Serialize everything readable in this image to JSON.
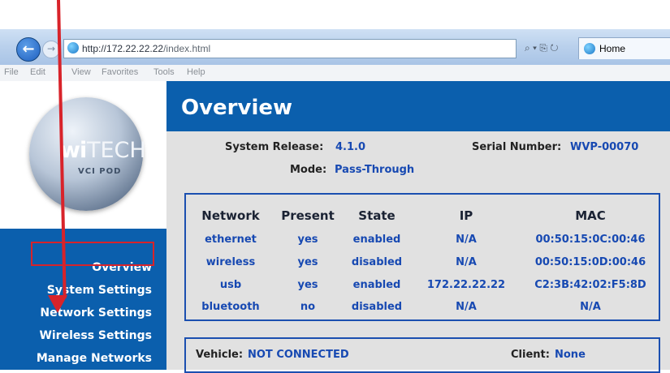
{
  "browser": {
    "url_prefix": "http://172.22.22.22",
    "url_path": "/index.html",
    "tools_glyphs": "⌕ ▾ ⎘ ↻",
    "tab_label": "Home",
    "menu": [
      "File",
      "Edit",
      "View",
      "Favorites",
      "Tools",
      "Help"
    ]
  },
  "logo": {
    "wi": "wi",
    "tech": "TECH",
    "sub": "VCI POD"
  },
  "sidebar": {
    "items": [
      {
        "label": "Overview"
      },
      {
        "label": "System Settings"
      },
      {
        "label": "Network Settings"
      },
      {
        "label": "Wireless Settings"
      },
      {
        "label": "Manage Networks"
      }
    ]
  },
  "page": {
    "title": "Overview",
    "system_release_label": "System Release:",
    "system_release_value": "4.1.0",
    "serial_label": "Serial Number:",
    "serial_value": "WVP-00070",
    "mode_label": "Mode:",
    "mode_value": "Pass-Through"
  },
  "network_table": {
    "headers": [
      "Network",
      "Present",
      "State",
      "IP",
      "MAC"
    ],
    "rows": [
      [
        "ethernet",
        "yes",
        "enabled",
        "N/A",
        "00:50:15:0C:00:46"
      ],
      [
        "wireless",
        "yes",
        "disabled",
        "N/A",
        "00:50:15:0D:00:46"
      ],
      [
        "usb",
        "yes",
        "enabled",
        "172.22.22.22",
        "C2:3B:42:02:F5:8D"
      ],
      [
        "bluetooth",
        "no",
        "disabled",
        "N/A",
        "N/A"
      ]
    ]
  },
  "status": {
    "vehicle_label": "Vehicle:",
    "vehicle_value": "NOT CONNECTED",
    "client_label": "Client:",
    "client_value": "None"
  },
  "colors": {
    "brand_blue": "#0b5fad",
    "value_blue": "#1749b2",
    "annotation_red": "#d8232a",
    "panel_gray": "#e1e1e1"
  }
}
